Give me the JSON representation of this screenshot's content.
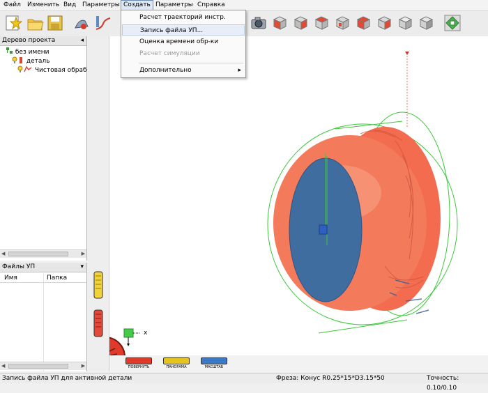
{
  "menu": {
    "items": [
      "Файл",
      "Изменить",
      "Вид",
      "Параметры",
      "Создать",
      "Параметры",
      "Справка"
    ],
    "active_index": 4
  },
  "dropdown": {
    "items": [
      {
        "label": "Расчет траекторий инстр.",
        "enabled": true
      },
      {
        "label": "Запись файла УП...",
        "enabled": true,
        "highlighted": true
      },
      {
        "label": "Оценка времени обр-ки",
        "enabled": true
      },
      {
        "label": "Расчет симуляции",
        "enabled": false
      },
      {
        "label": "Дополнительно",
        "enabled": true,
        "submenu": true
      }
    ],
    "submenu_arrow": "▸"
  },
  "project_tree": {
    "title": "Дерево проекта",
    "pin_glyph": "◂",
    "nodes": [
      {
        "label": "без имени",
        "icon": "project-icon"
      },
      {
        "label": "деталь",
        "icon": "part-icon"
      },
      {
        "label": "Чистовая обрабоТ",
        "icon": "operation-icon"
      }
    ]
  },
  "files_panel": {
    "title": "Файлы УП",
    "dropdown_glyph": "▾",
    "columns": [
      "Имя",
      "Папка"
    ]
  },
  "view_controls": {
    "rotate_label": "ПОВЕРНУТЬ",
    "pan_label": "ПАНОРАМА",
    "zoom_label": "МАСШТАБ"
  },
  "axis_label": "x",
  "status": {
    "message": "Запись файла УП для активной детали",
    "tool": "Фреза: Конус R0.25*15*D3.15*50",
    "tolerance": "Точность: 0.10/0.10"
  },
  "colors": {
    "part": "#f36c4f",
    "face": "#3f6d9f",
    "bounding": "#3cc83c",
    "accent_red": "#e03a2a",
    "accent_yellow": "#e6c41e",
    "accent_blue": "#3a78c8"
  }
}
